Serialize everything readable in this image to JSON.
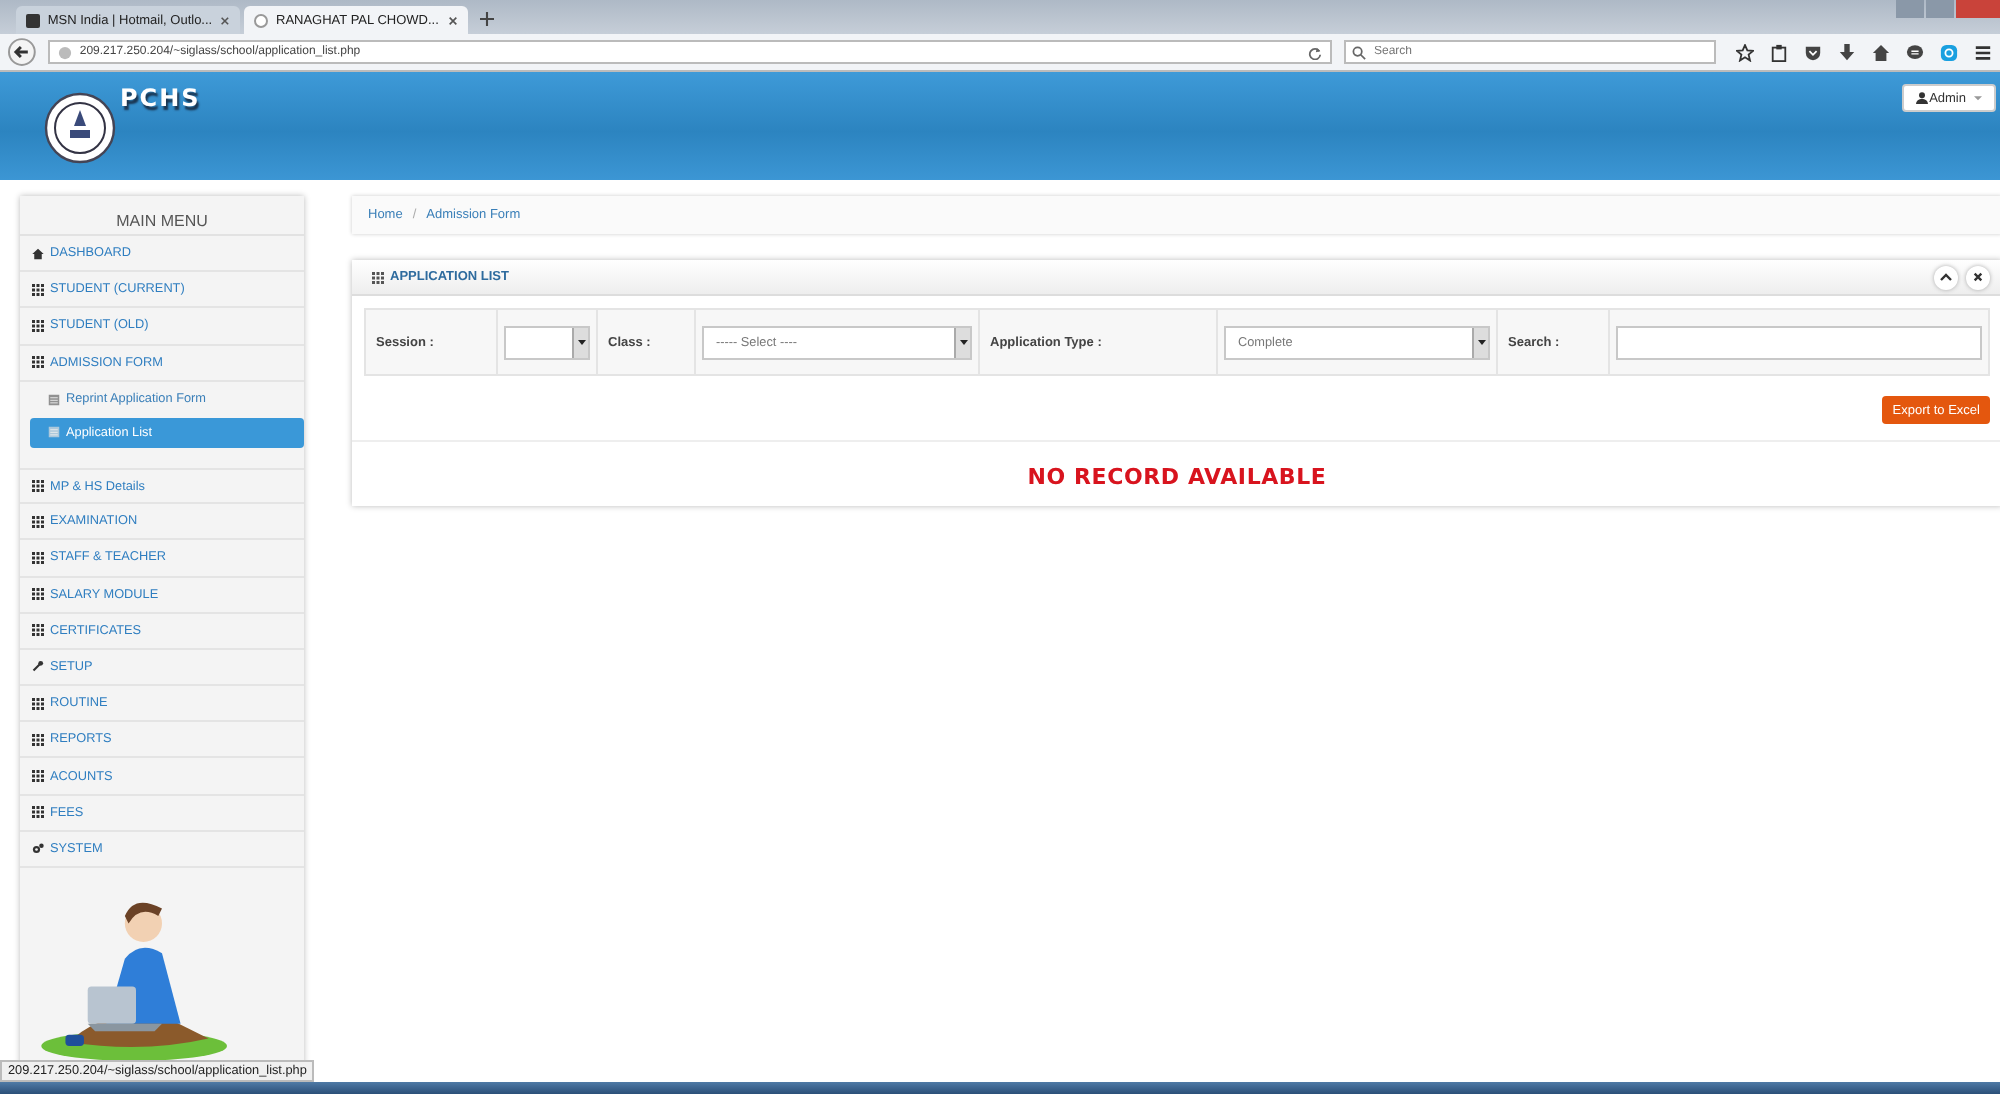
{
  "browser": {
    "tabs": [
      {
        "title": "MSN India | Hotmail, Outlo...",
        "selected": false
      },
      {
        "title": "RANAGHAT PAL CHOWD...",
        "selected": true
      }
    ],
    "url": "209.217.250.204/~siglass/school/application_list.php",
    "search": {
      "placeholder": "Search"
    }
  },
  "header": {
    "logo_text": "PCHS",
    "user_menu": "Admin"
  },
  "sidebar": {
    "title": "MAIN MENU",
    "items": [
      {
        "label": "DASHBOARD",
        "kind": "section",
        "selected": false
      },
      {
        "label": "STUDENT (CURRENT)",
        "kind": "section",
        "selected": false
      },
      {
        "label": "STUDENT (OLD)",
        "kind": "section",
        "selected": false
      },
      {
        "label": "ADMISSION FORM",
        "kind": "section",
        "selected": false
      },
      {
        "label": "Reprint Application Form",
        "kind": "subitem",
        "selected": false
      },
      {
        "label": "Application List",
        "kind": "subitem",
        "selected": true
      },
      {
        "label": "MP & HS Details",
        "kind": "section",
        "selected": false
      },
      {
        "label": "EXAMINATION",
        "kind": "section",
        "selected": false
      },
      {
        "label": "STAFF & TEACHER",
        "kind": "section",
        "selected": false
      },
      {
        "label": "SALARY MODULE",
        "kind": "section",
        "selected": false
      },
      {
        "label": "CERTIFICATES",
        "kind": "section",
        "selected": false
      },
      {
        "label": "SETUP",
        "kind": "section",
        "selected": false
      },
      {
        "label": "ROUTINE",
        "kind": "section",
        "selected": false
      },
      {
        "label": "REPORTS",
        "kind": "section",
        "selected": false
      },
      {
        "label": "ACOUNTS",
        "kind": "section",
        "selected": false
      },
      {
        "label": "FEES",
        "kind": "section",
        "selected": false
      },
      {
        "label": "SYSTEM",
        "kind": "section",
        "selected": false
      }
    ]
  },
  "breadcrumb": {
    "separator": "/",
    "items": [
      "Home",
      "Admission Form"
    ]
  },
  "panel": {
    "title": "APPLICATION LIST",
    "filters": [
      {
        "label": "Session :",
        "kind": "select"
      },
      {
        "label": "Class :",
        "kind": "select",
        "value": "----- Select ----"
      },
      {
        "label": "Application Type :",
        "kind": "select",
        "value": "Complete"
      },
      {
        "label": "Search :",
        "kind": "text"
      }
    ],
    "export_button": "Export to Excel",
    "empty_message": "NO RECORD AVAILABLE"
  },
  "status_url": "209.217.250.204/~siglass/school/application_list.php"
}
